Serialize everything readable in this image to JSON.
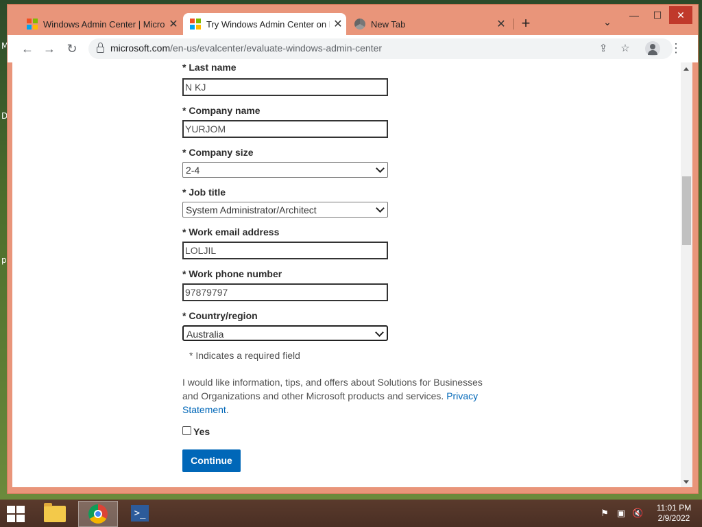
{
  "desktop": {
    "edge_letters": [
      "M",
      "D",
      "p"
    ]
  },
  "browser": {
    "tabs": [
      {
        "title": "Windows Admin Center | Micros",
        "active": false,
        "icon": "microsoft-logo-icon"
      },
      {
        "title": "Try Windows Admin Center on M",
        "active": true,
        "icon": "microsoft-logo-icon"
      },
      {
        "title": "New Tab",
        "active": false,
        "icon": "chrome-icon"
      }
    ],
    "new_tab_symbol": "+",
    "tab_search_symbol": "⌄",
    "window_controls": {
      "minimize": "—",
      "maximize": "☐",
      "close": "✕"
    },
    "url_host": "microsoft.com",
    "url_path": "/en-us/evalcenter/evaluate-windows-admin-center"
  },
  "form": {
    "last_name": {
      "label": "* Last name",
      "value": "N  KJ"
    },
    "company_name": {
      "label": "* Company name",
      "value": "YURJOM"
    },
    "company_size": {
      "label": "* Company size",
      "value": "2-4"
    },
    "job_title": {
      "label": "* Job title",
      "value": "System Administrator/Architect"
    },
    "work_email": {
      "label": "* Work email address",
      "value": "LOLJIL"
    },
    "work_phone": {
      "label": "* Work phone number",
      "value": "97879797"
    },
    "country": {
      "label": "* Country/region",
      "value": "Australia"
    },
    "required_note": "* Indicates a required field",
    "consent_text": "I would like information, tips, and offers about Solutions for Businesses and Organizations and other Microsoft products and services.",
    "privacy_link": "Privacy Statement",
    "yes_label": "Yes",
    "continue_label": "Continue"
  },
  "taskbar": {
    "clock_time": "11:01 PM",
    "clock_date": "2/9/2022"
  },
  "colors": {
    "accent": "#0067b8",
    "tab_strip": "#e9957a",
    "taskbar": "#4a2f24"
  }
}
